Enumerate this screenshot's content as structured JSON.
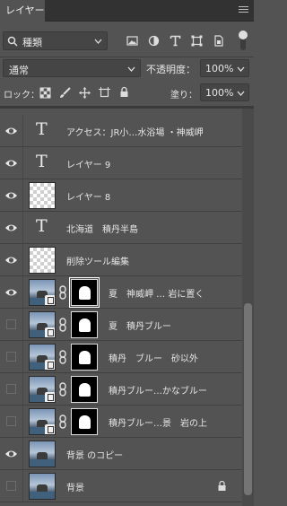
{
  "panel": {
    "tab_label": "レイヤー"
  },
  "filter": {
    "kind_label": "種類",
    "icons": [
      "image-filter-icon",
      "adjustment-filter-icon",
      "type-filter-icon",
      "shape-filter-icon",
      "smart-object-filter-icon"
    ]
  },
  "blend": {
    "mode": "通常",
    "opacity_label": "不透明度：",
    "opacity_value": "100%"
  },
  "lock": {
    "label": "ロック：",
    "fill_label": "塗り：",
    "fill_value": "100%"
  },
  "layers": [
    {
      "name": "アクセス：JR小…水浴場 ・神威岬",
      "kind": "text",
      "visible": true
    },
    {
      "name": "レイヤー 9",
      "kind": "text",
      "visible": true
    },
    {
      "name": "レイヤー 8",
      "kind": "empty",
      "visible": true
    },
    {
      "name": "北海道　積丹半島",
      "kind": "text",
      "visible": true
    },
    {
      "name": "削除ツール編集",
      "kind": "empty",
      "visible": true
    },
    {
      "name": "夏　神威岬 … 岩に置く",
      "kind": "masked",
      "visible": true
    },
    {
      "name": "夏　積丹ブルー",
      "kind": "masked",
      "visible": false
    },
    {
      "name": "積丹　ブルー　砂以外",
      "kind": "masked",
      "visible": false
    },
    {
      "name": "積丹ブルー…かなブルー",
      "kind": "masked",
      "visible": false
    },
    {
      "name": "積丹ブルー…景　岩の上",
      "kind": "masked",
      "visible": false
    },
    {
      "name": "背景 のコピー",
      "kind": "photo",
      "visible": true
    },
    {
      "name": "背景",
      "kind": "photo",
      "visible": false,
      "locked": true
    }
  ]
}
